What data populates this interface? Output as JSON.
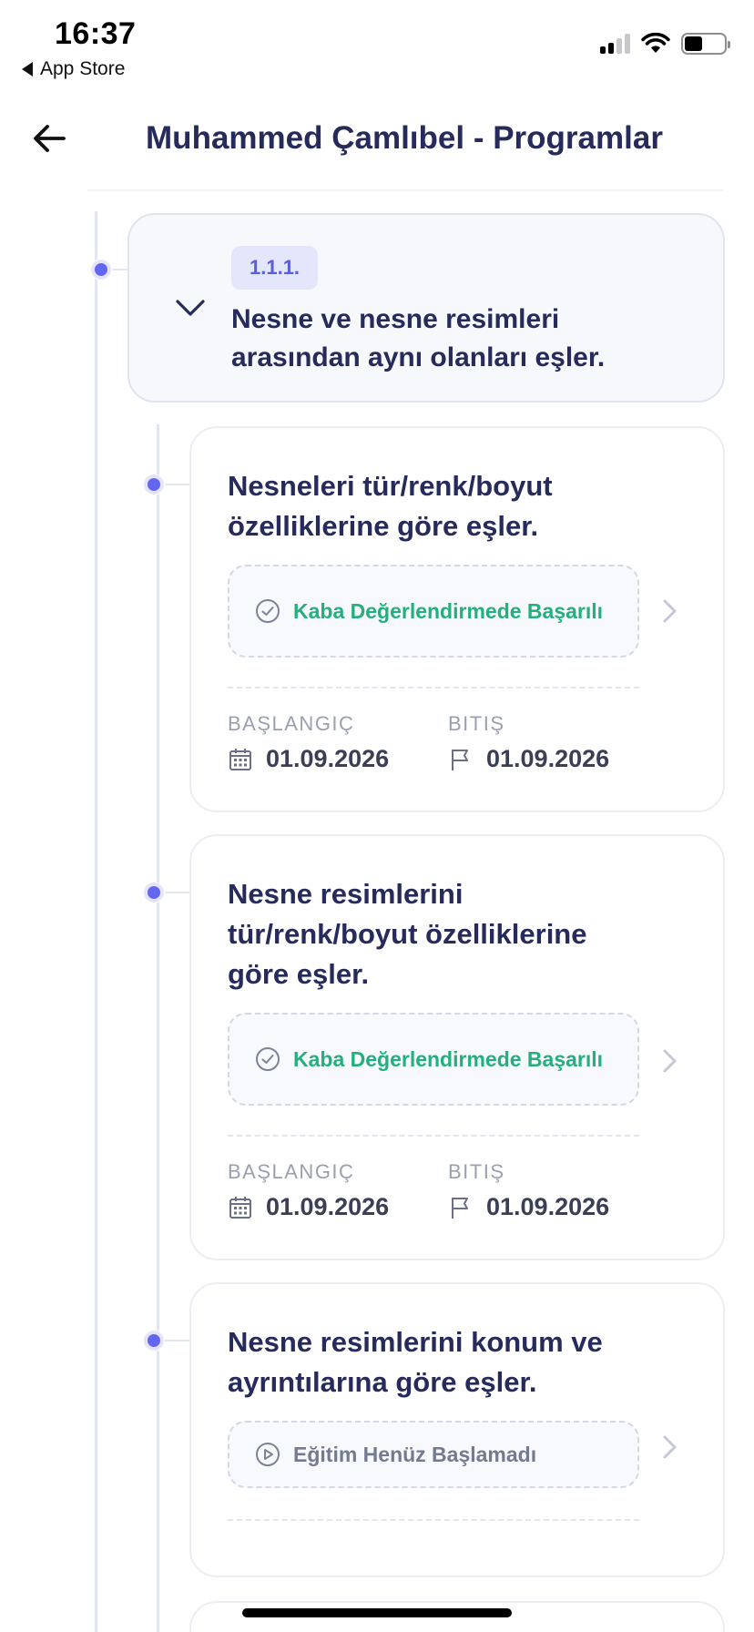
{
  "status_bar": {
    "time": "16:37",
    "back_label": "App Store"
  },
  "header": {
    "title": "Muhammed Çamlıbel - Programlar"
  },
  "parent": {
    "badge": "1.1.1.",
    "title": "Nesne ve nesne resimleri arasından aynı olanları eşler."
  },
  "cards": [
    {
      "title": "Nesneleri tür/renk/boyut özelliklerine göre eşler.",
      "status": "Kaba Değerlendirmede Başarılı",
      "status_type": "success",
      "start_label": "BAŞLANGIÇ",
      "start_date": "01.09.2026",
      "end_label": "BITIŞ",
      "end_date": "01.09.2026"
    },
    {
      "title": "Nesne resimlerini tür/renk/boyut özelliklerine göre eşler.",
      "status": "Kaba Değerlendirmede Başarılı",
      "status_type": "success",
      "start_label": "BAŞLANGIÇ",
      "start_date": "01.09.2026",
      "end_label": "BITIŞ",
      "end_date": "01.09.2026"
    },
    {
      "title": "Nesne resimlerini konum ve ayrıntılarına göre eşler.",
      "status": "Eğitim Henüz Başlamadı",
      "status_type": "pending"
    }
  ],
  "colors": {
    "accent": "#6366f1",
    "success": "#22b07d",
    "title": "#262b5c"
  }
}
